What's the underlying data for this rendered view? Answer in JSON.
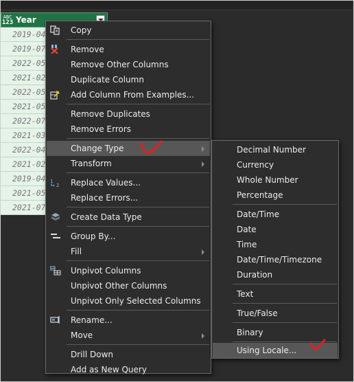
{
  "column": {
    "type_badge_top": "ABC",
    "type_badge_bottom": "123",
    "title": "Year",
    "rows": [
      "2019-04",
      "2019-07",
      "2022-05",
      "2021-02",
      "2022-05",
      "2021-05",
      "2022-07",
      "2021-03",
      "2022-04",
      "2021-02",
      "2019-04",
      "2021-05",
      "2021-07"
    ]
  },
  "context_menu": {
    "items": [
      {
        "label": "Copy",
        "icon": "copy-icon"
      },
      {
        "label": "Remove",
        "icon": "remove-column-icon"
      },
      {
        "label": "Remove Other Columns"
      },
      {
        "label": "Duplicate Column"
      },
      {
        "label": "Add Column From Examples...",
        "icon": "add-column-from-examples-icon"
      },
      {
        "label": "Remove Duplicates"
      },
      {
        "label": "Remove Errors"
      },
      {
        "label": "Change Type",
        "has_submenu": true,
        "highlighted": true
      },
      {
        "label": "Transform",
        "has_submenu": true
      },
      {
        "label": "Replace Values...",
        "icon": "replace-values-icon"
      },
      {
        "label": "Replace Errors..."
      },
      {
        "label": "Create Data Type",
        "icon": "data-type-icon"
      },
      {
        "label": "Group By...",
        "icon": "group-by-icon"
      },
      {
        "label": "Fill",
        "has_submenu": true
      },
      {
        "label": "Unpivot Columns",
        "icon": "unpivot-icon"
      },
      {
        "label": "Unpivot Other Columns"
      },
      {
        "label": "Unpivot Only Selected Columns"
      },
      {
        "label": "Rename...",
        "icon": "rename-icon"
      },
      {
        "label": "Move",
        "has_submenu": true
      },
      {
        "label": "Drill Down"
      },
      {
        "label": "Add as New Query"
      }
    ]
  },
  "change_type_submenu": {
    "items": [
      {
        "label": "Decimal Number"
      },
      {
        "label": "Currency"
      },
      {
        "label": "Whole Number"
      },
      {
        "label": "Percentage"
      },
      {
        "label": "Date/Time"
      },
      {
        "label": "Date"
      },
      {
        "label": "Time"
      },
      {
        "label": "Date/Time/Timezone"
      },
      {
        "label": "Duration"
      },
      {
        "label": "Text"
      },
      {
        "label": "True/False"
      },
      {
        "label": "Binary"
      },
      {
        "label": "Using Locale...",
        "highlighted": true
      }
    ]
  },
  "colors": {
    "header_green": "#217346",
    "row_bg": "#e6f3e8",
    "menu_bg": "#2d2d2d",
    "highlight": "#575757",
    "annotation_red": "#e02020"
  }
}
